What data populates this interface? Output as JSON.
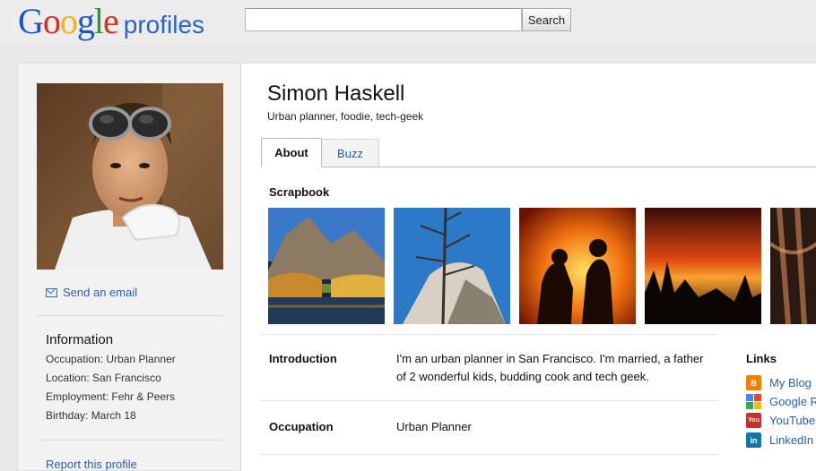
{
  "header": {
    "logo_letters": [
      {
        "ch": "G",
        "color": "#1a55c6"
      },
      {
        "ch": "o",
        "color": "#d72e1e"
      },
      {
        "ch": "o",
        "color": "#f0b416"
      },
      {
        "ch": "g",
        "color": "#1a55c6"
      },
      {
        "ch": "l",
        "color": "#1f9a3d"
      },
      {
        "ch": "e",
        "color": "#d72e1e"
      }
    ],
    "product": "profiles",
    "search_value": "",
    "search_button": "Search"
  },
  "sidebar": {
    "send_email": "Send an email",
    "info_title": "Information",
    "info_lines": [
      "Occupation: Urban Planner",
      "Location: San Francisco",
      "Employment: Fehr & Peers",
      "Birthday: March 18"
    ],
    "report": "Report this profile"
  },
  "profile": {
    "name": "Simon Haskell",
    "tagline": "Urban planner, foodie, tech-geek",
    "tabs": [
      "About",
      "Buzz"
    ],
    "active_tab": "About"
  },
  "scrapbook": {
    "title": "Scrapbook",
    "photos": [
      "yosemite-lake-photo",
      "half-dome-tree-photo",
      "concert-photo",
      "sunset-trees-photo",
      "forest-photo"
    ]
  },
  "about": {
    "rows": [
      {
        "label": "Introduction",
        "text": "I'm an urban planner in San Francisco. I'm married, a father of 2 wonderful kids, budding cook and tech geek."
      },
      {
        "label": "Occupation",
        "text": "Urban Planner"
      }
    ]
  },
  "links": {
    "title": "Links",
    "items": [
      {
        "label": "My Blog",
        "icon": "blogger-icon",
        "color": "#f57d00",
        "glyph": "B"
      },
      {
        "label": "Google R",
        "icon": "google-reader-icon",
        "color": "#ffffff",
        "glyph": ""
      },
      {
        "label": "YouTube",
        "icon": "youtube-icon",
        "color": "#c4302b",
        "glyph": "You"
      },
      {
        "label": "LinkedIn",
        "icon": "linkedin-icon",
        "color": "#0e76a8",
        "glyph": "in"
      }
    ]
  }
}
